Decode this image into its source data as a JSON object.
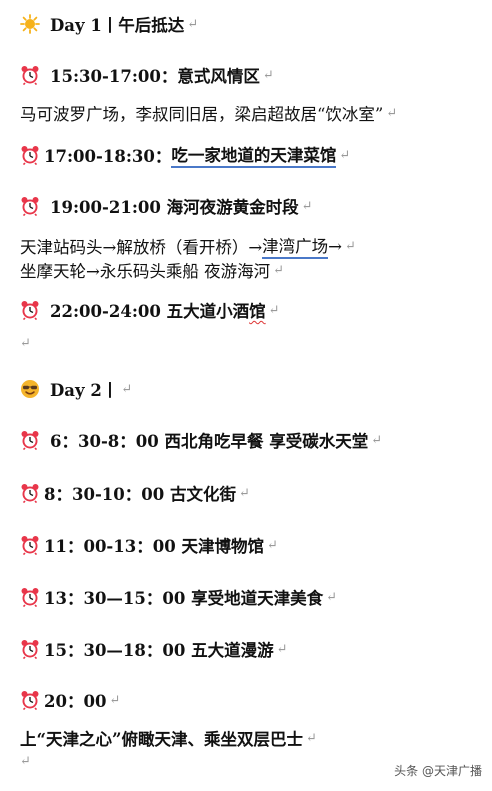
{
  "day1": {
    "header": "Day 1丨午后抵达",
    "items": [
      {
        "time": "15:30-17:00：意式风情区"
      },
      {
        "desc": "马可波罗广场，李叔同旧居，梁启超故居“饮冰室”"
      },
      {
        "time": "17:00-18:30：",
        "title_underlined": "吃一家地道的天津菜馆"
      },
      {
        "time": "19:00-21:00 海河夜游黄金时段"
      },
      {
        "desc_a": "天津站码头→解放桥（看开桥）→",
        "desc_link": "津湾广场",
        "desc_b": "→"
      },
      {
        "desc": "坐摩天轮→永乐码头乘船  夜游海河"
      },
      {
        "time": "22:00-24:00 五大道小酒",
        "time_squiggle": "馆"
      }
    ]
  },
  "day2": {
    "header": "Day 2丨",
    "items": [
      {
        "time": "6：30-8：00 西北角吃早餐 享受碳水天堂"
      },
      {
        "time": "8：30-10：00 古文化街"
      },
      {
        "time": "11：00-13：00 天津博物馆"
      },
      {
        "time": "13：30—15：00 享受地道天津美食"
      },
      {
        "time": "15：30—18：00 五大道漫游"
      },
      {
        "time": "20：00"
      },
      {
        "desc": "上“天津之心”俯瞰天津、乘坐双层巴士"
      }
    ]
  },
  "paragraph_mark": "↵",
  "watermark": "头条 @天津广播",
  "icons": {
    "sun": "sun-icon",
    "alarm": "alarm-clock-icon",
    "smiley": "cool-smiley-icon"
  },
  "colors": {
    "alarm": "#e8364a",
    "sun": "#f6b21b",
    "link_underline": "#4a78c8",
    "spell_squiggle": "#d33"
  }
}
